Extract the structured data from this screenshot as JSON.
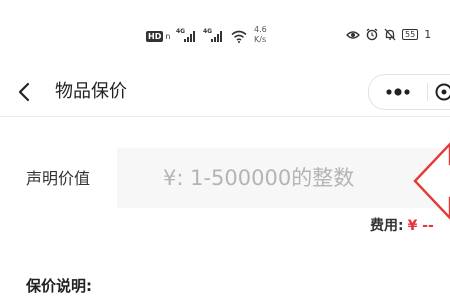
{
  "status_bar": {
    "hd_label": "HD",
    "hd_suffix": "n",
    "signal_1_label": "4G",
    "signal_2_label": "4G",
    "speed_value": "4.6",
    "speed_unit": "K/s",
    "battery_level": "55",
    "time_partial": "1",
    "icons": [
      "hd-icon",
      "signal-icon",
      "signal-icon",
      "wifi-icon",
      "eye-icon",
      "alarm-icon",
      "mute-icon",
      "battery-icon"
    ]
  },
  "nav": {
    "back_icon": "chevron-left-icon",
    "title": "物品保价",
    "more_icon": "more-dots-icon",
    "close_icon": "close-circle-icon"
  },
  "form": {
    "declared_value_label": "声明价值",
    "declared_value_input": "",
    "declared_value_placeholder": "¥: 1-500000的整数",
    "fee_label": "费用:",
    "fee_value": "¥ --"
  },
  "notes": {
    "title": "保价说明:"
  },
  "annotation": {
    "arrow_color": "#e53935"
  },
  "colors": {
    "accent_red": "#e8333c",
    "input_bg": "#f7f7f7",
    "placeholder": "#b4b4b4"
  }
}
